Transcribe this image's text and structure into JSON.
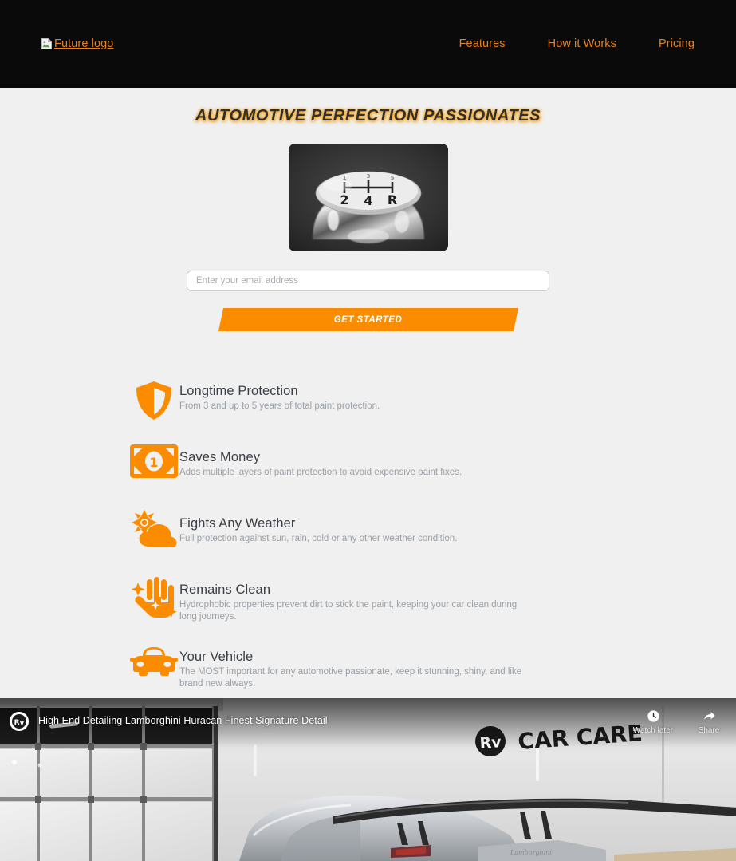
{
  "header": {
    "logo_alt": "Future logo",
    "nav": [
      {
        "label": "Features"
      },
      {
        "label": "How it Works"
      },
      {
        "label": "Pricing"
      }
    ]
  },
  "hero": {
    "title": "AUTOMOTIVE PERFECTION PASSIONATES",
    "image_description": "Chrome manual gear shift knob with shift pattern 1-3-5 / 2-4-R",
    "email_placeholder": "Enter your email address",
    "email_value": "",
    "cta_label": "GET STARTED"
  },
  "features": [
    {
      "icon": "shield-icon",
      "title": "Longtime Protection",
      "description": "From 3 and up to 5 years of total paint protection."
    },
    {
      "icon": "money-icon",
      "title": "Saves Money",
      "description": "Adds multiple layers of paint protection to avoid expensive paint fixes."
    },
    {
      "icon": "sun-cloud-icon",
      "title": "Fights Any Weather",
      "description": "Full protection against sun, rain, cold or any other weather condition."
    },
    {
      "icon": "sparkle-hand-icon",
      "title": "Remains Clean",
      "description": "Hydrophobic properties prevent dirt to stick the paint, keeping your car clean during long journeys."
    },
    {
      "icon": "car-icon",
      "title": "Your Vehicle",
      "description": "The MOST important for any automotive passionate, keep it stunning, shiny, and like brand new always."
    }
  ],
  "video": {
    "title": "High End Detailing Lamborghini Huracan Finest Signature Detail",
    "channel_avatar_alt": "RV Car Care channel avatar",
    "wall_logo_text": "CAR CARE",
    "wall_logo_mark": "Rv",
    "actions": [
      {
        "icon": "clock-icon",
        "label": "Watch later"
      },
      {
        "icon": "share-icon",
        "label": "Share"
      }
    ]
  },
  "colors": {
    "accent_orange": "#fb8c00",
    "nav_orange": "#e8811a",
    "header_black": "#0a0a0a",
    "page_background": "#f0f0f0",
    "title_gray": "#3a3f45",
    "description_gray": "#9aa0a6"
  }
}
